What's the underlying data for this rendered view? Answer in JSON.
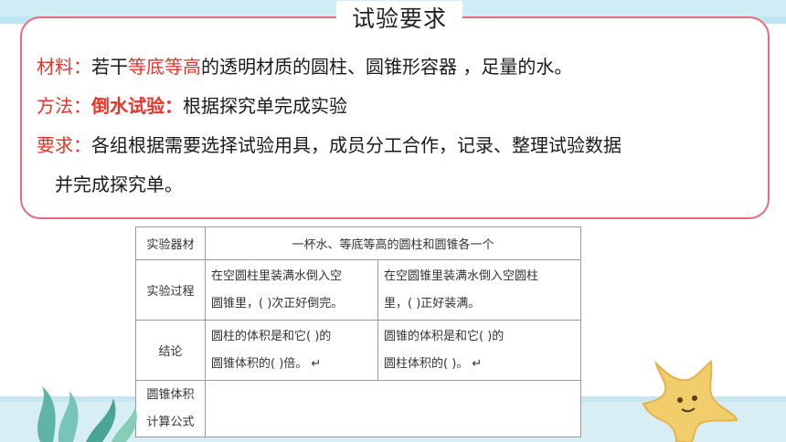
{
  "title": "试验要求",
  "materials": {
    "label": "材料：",
    "prefix": "若干",
    "highlight": "等底等高",
    "suffix": "的透明材质的圆柱、圆锥形容器 ，足量的水。"
  },
  "method": {
    "label": "方法：",
    "highlight": "倒水试验：",
    "suffix": "根据探究单完成实验"
  },
  "requirement": {
    "label": "要求：",
    "line1": "各组根据需要选择试验用具，成员分工合作，记录、整理试验数据",
    "line2": "并完成探究单。"
  },
  "table": {
    "rows": [
      {
        "head": "实验器材",
        "content": "一杯水、等底等高的圆柱和圆锥各一个"
      },
      {
        "head": "实验过程",
        "left": [
          "在空圆柱里装满水倒入空",
          "圆锥里，(    )次正好倒完。"
        ],
        "right": [
          "在空圆锥里装满水倒入空圆柱",
          "里，(        )正好装满。"
        ]
      },
      {
        "head": "结论",
        "left": [
          "圆柱的体积是和它(        )的",
          "圆锥体积的(        )倍。 ↵"
        ],
        "right": [
          "圆锥的体积是和它(              )的",
          "圆柱体积的(        )。 ↵"
        ]
      },
      {
        "head": [
          "圆锥体积",
          "计算公式"
        ],
        "content": ""
      }
    ]
  },
  "colors": {
    "accent_red": "#e8332a",
    "card_border": "#e96a7a",
    "band": "#cfeef6"
  }
}
